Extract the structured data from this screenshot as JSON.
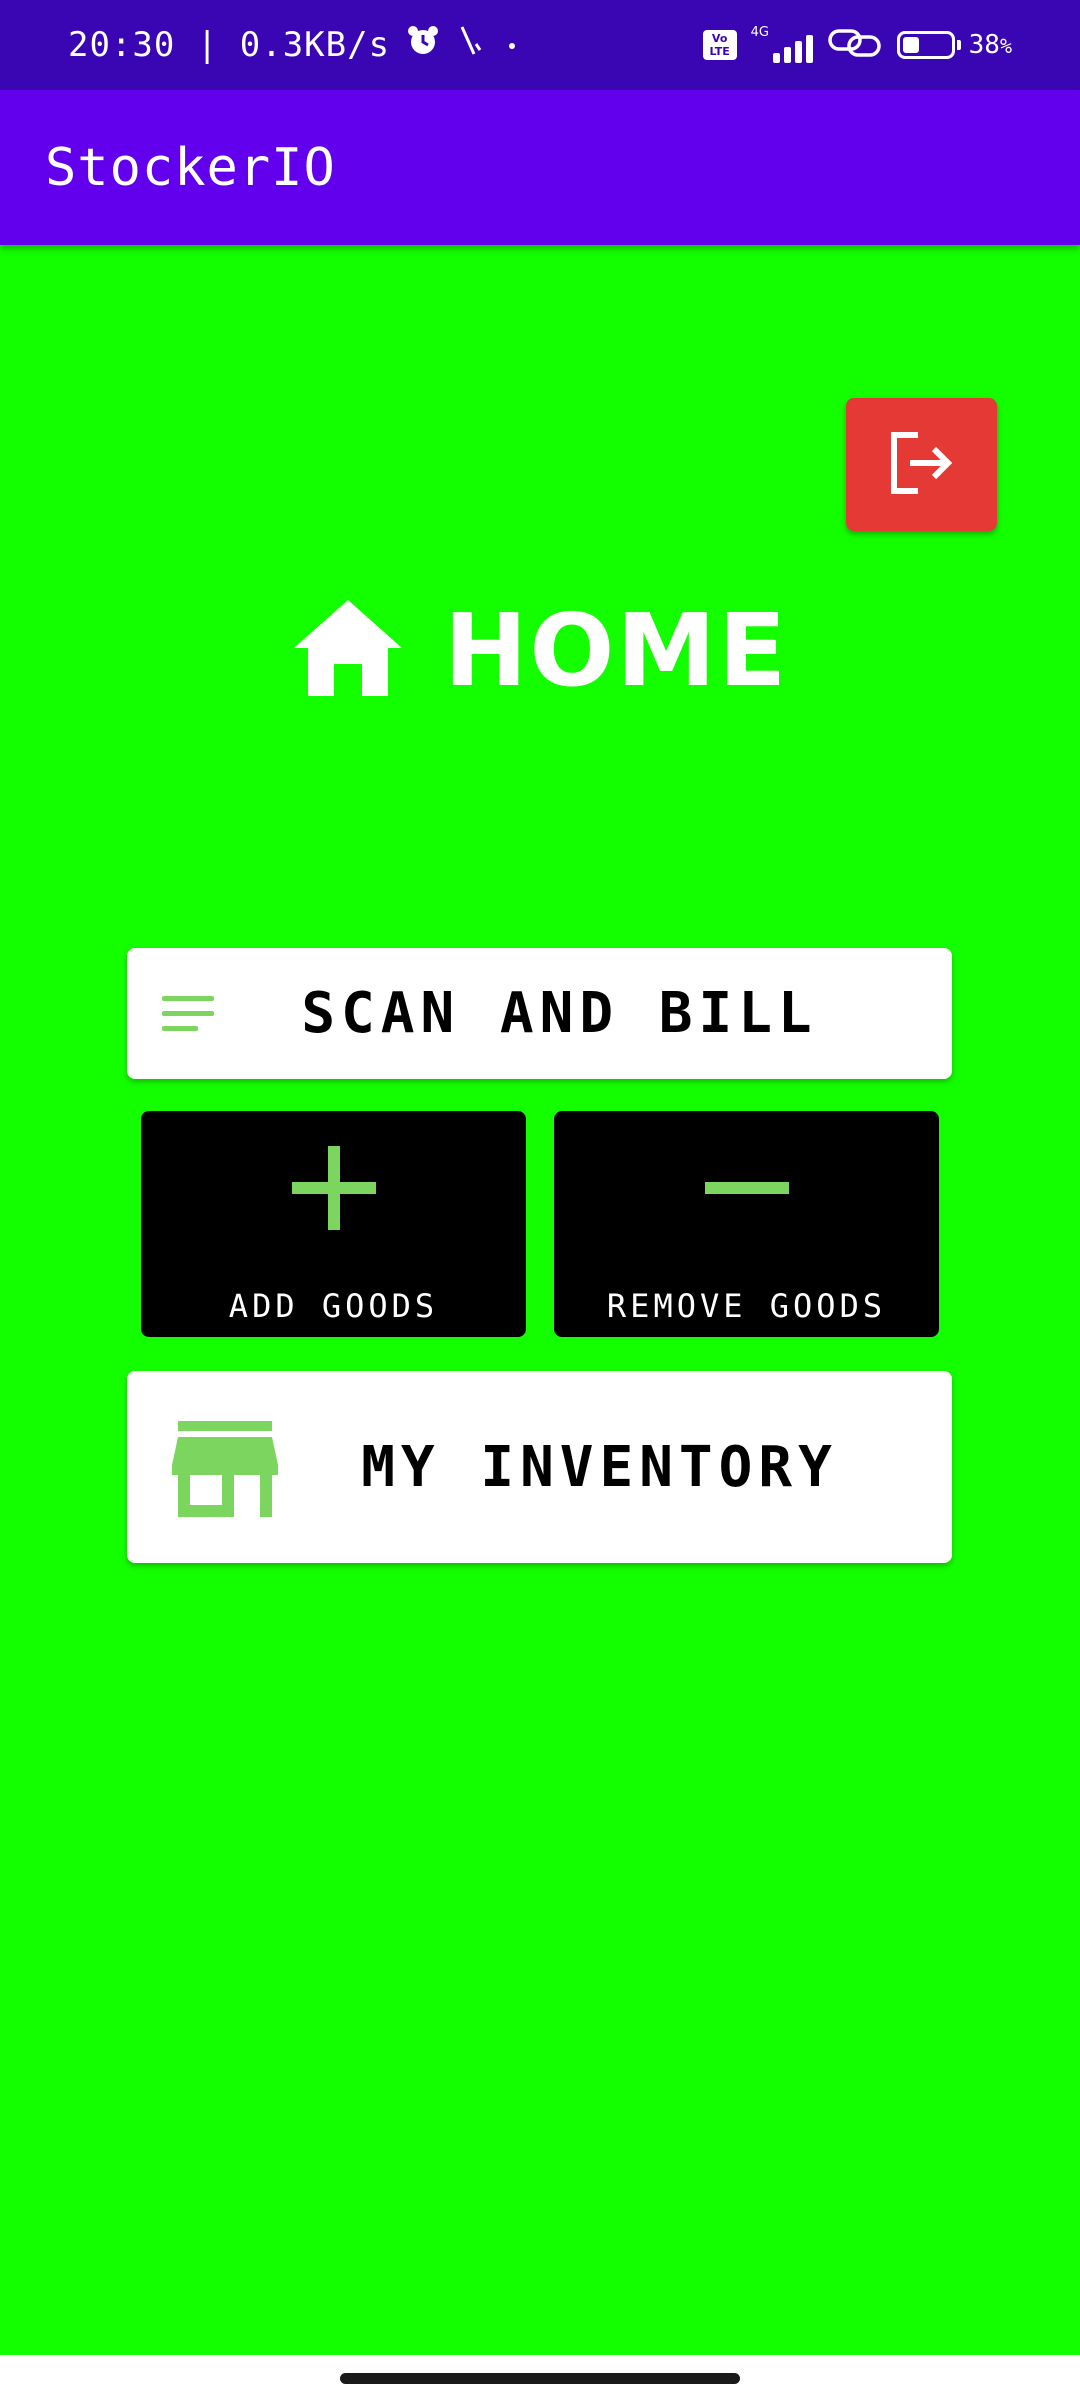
{
  "status_bar": {
    "time_speed": "20:30 | 0.3KB/s",
    "network_type": "4G",
    "volte_label": "Vo\nLTE",
    "battery_percent": "38",
    "battery_suffix": "%",
    "icons": [
      "alarm-icon",
      "activity-icon",
      "dot-icon",
      "volte-icon",
      "signal-icon",
      "link-icon",
      "battery-icon"
    ]
  },
  "app_bar": {
    "title": "StockerIO"
  },
  "logout": {
    "icon": "logout-icon",
    "color": "#e53935"
  },
  "home": {
    "icon": "home-icon",
    "title": "HOME"
  },
  "actions": {
    "scan_bill": {
      "label": "SCAN AND BILL",
      "icon": "menu-lines-icon"
    },
    "add_goods": {
      "label": "ADD GOODS",
      "icon": "plus-icon"
    },
    "remove_goods": {
      "label": "REMOVE GOODS",
      "icon": "minus-icon"
    },
    "my_inventory": {
      "label": "MY INVENTORY",
      "icon": "store-icon"
    }
  },
  "colors": {
    "status_bar": "#3a05b2",
    "app_bar": "#6200ee",
    "background": "#13ff00",
    "icon_green": "#7bd55f",
    "tile_bg": "#000000"
  }
}
